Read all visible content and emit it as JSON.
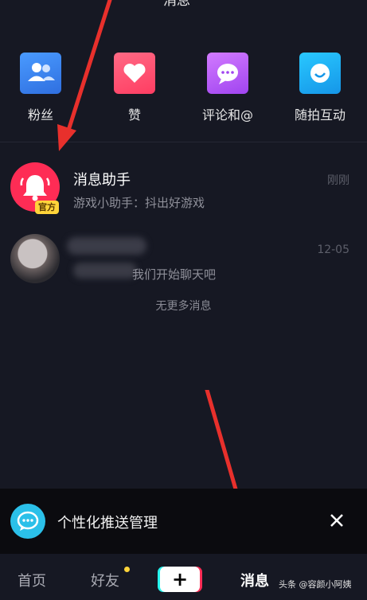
{
  "header": {
    "title": "消息",
    "right_text": "···"
  },
  "quick_actions": [
    {
      "label": "粉丝",
      "icon": "fans-icon"
    },
    {
      "label": "赞",
      "icon": "heart-icon"
    },
    {
      "label": "评论和@",
      "icon": "comment-icon"
    },
    {
      "label": "随拍互动",
      "icon": "interaction-icon"
    }
  ],
  "messages": [
    {
      "name": "消息助手",
      "preview": "游戏小助手：抖出好游戏",
      "time": "刚刚",
      "badge": "官方"
    },
    {
      "name": "",
      "preview": "我们开始聊天吧",
      "time": "12-05"
    }
  ],
  "list_end_text": "无更多消息",
  "push_bar": {
    "text": "个性化推送管理"
  },
  "tabbar": {
    "home": "首页",
    "friends": "好友",
    "plus": "+",
    "messages": "消息"
  },
  "watermark": "头条 @容颜小阿姨",
  "colors": {
    "background": "#161823",
    "accent_red": "#fe2c55",
    "accent_cyan": "#25f4ee",
    "badge_yellow": "#ffd43a"
  }
}
